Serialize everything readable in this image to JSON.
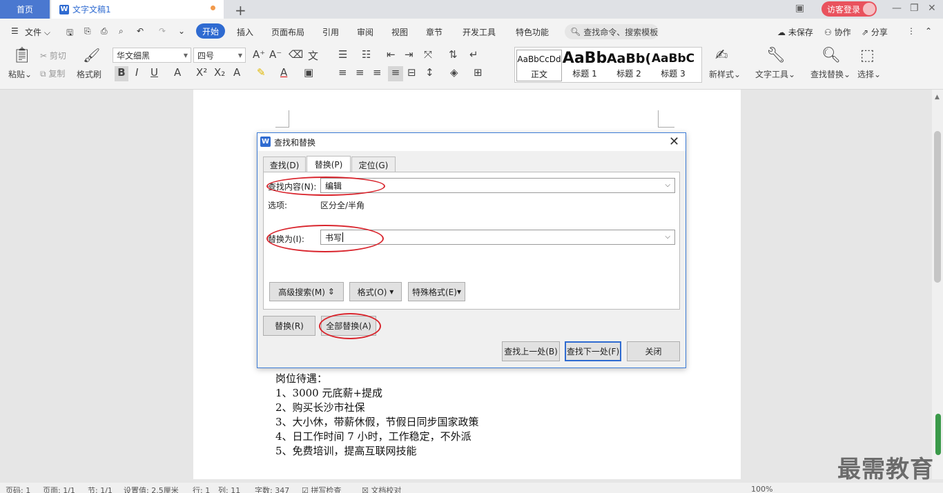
{
  "titlebar": {
    "home_tab": "首页",
    "doc_tab": "文字文稿1",
    "new_tab": "+",
    "login_button": "访客登录"
  },
  "menubar": {
    "file": "文件",
    "start": "开始",
    "items": [
      "插入",
      "页面布局",
      "引用",
      "审阅",
      "视图",
      "章节",
      "开发工具",
      "特色功能"
    ],
    "search_cmd": "查找命令、搜索模板",
    "unsaved": "未保存",
    "collab": "协作",
    "share": "分享"
  },
  "ribbon": {
    "paste": "粘贴",
    "cut": "剪切",
    "copy": "复制",
    "format_painter": "格式刷",
    "font_name": "华文细黑",
    "font_size": "四号",
    "styles": [
      {
        "preview": "AaBbCcDd",
        "name": "正文"
      },
      {
        "preview": "AaBb",
        "name": "标题 1"
      },
      {
        "preview": "AaBb(",
        "name": "标题 2"
      },
      {
        "preview": "AaBbC",
        "name": "标题 3"
      }
    ],
    "new_style": "新样式",
    "text_tools": "文字工具",
    "find_replace": "查找替换",
    "select": "选择"
  },
  "dialog": {
    "title": "查找和替换",
    "tabs": [
      "查找(D)",
      "替换(P)",
      "定位(G)"
    ],
    "find_label": "查找内容(N):",
    "find_value": "编辑",
    "options_label": "选项:",
    "options_value": "区分全/半角",
    "replace_label": "替换为(I):",
    "replace_value": "书写",
    "advanced_search": "高级搜索(M)",
    "format": "格式(O)",
    "special_format": "特殊格式(E)",
    "replace_button": "替换(R)",
    "replace_all_button": "全部替换(A)",
    "find_prev": "查找上一处(B)",
    "find_next": "查找下一处(F)",
    "close": "关闭"
  },
  "document": {
    "lines": [
      "岗位待遇：",
      "1、3000 元底薪+提成",
      "2、购买长沙市社保",
      "3、大小休，带薪休假，节假日同步国家政策",
      "4、日工作时间 7 小时，工作稳定，不外派",
      "5、免费培训，提高互联网技能"
    ]
  },
  "statusbar": {
    "page": "页码: 1",
    "pages": "页面: 1/1",
    "section": "节: 1/1",
    "setting": "设置值: 2.5厘米",
    "row": "行: 1",
    "col": "列: 11",
    "words": "字数: 347",
    "spell": "拼写检查",
    "proof": "文档校对",
    "zoom": "100%"
  },
  "watermark": "最需教育"
}
